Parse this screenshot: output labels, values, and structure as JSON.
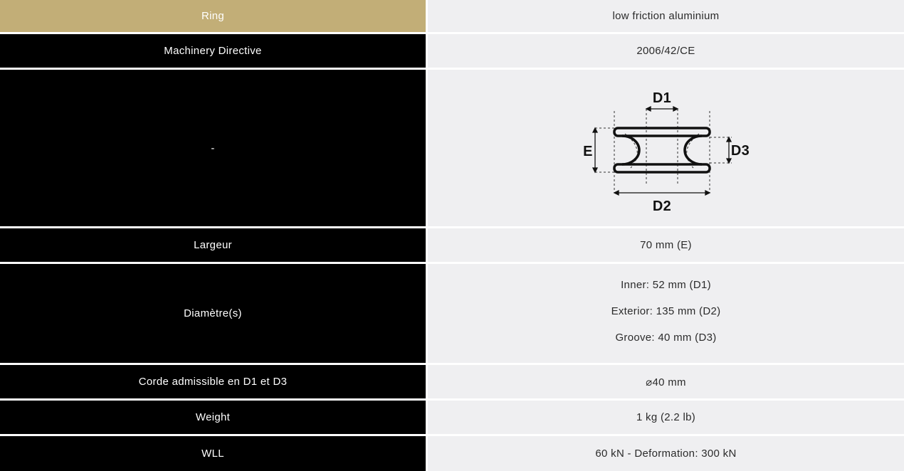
{
  "colors": {
    "header_label_bg": "#c2ae77",
    "label_bg": "#000000",
    "value_bg": "#efeff1"
  },
  "rows": [
    {
      "label": "Ring",
      "value": "low friction aluminium"
    },
    {
      "label": "Machinery Directive",
      "value": "2006/42/CE"
    },
    {
      "label": "-",
      "diagram_labels": {
        "d1": "D1",
        "d2": "D2",
        "d3": "D3",
        "e": "E"
      }
    },
    {
      "label": "Largeur",
      "value": "70 mm (E)"
    },
    {
      "label": "Diamètre(s)",
      "values": [
        "Inner: 52 mm (D1)",
        "Exterior: 135 mm (D2)",
        "Groove: 40 mm (D3)"
      ]
    },
    {
      "label": "Corde admissible en D1 et D3",
      "value": "⌀40 mm"
    },
    {
      "label": "Weight",
      "value": "1 kg (2.2 lb)"
    },
    {
      "label": "WLL",
      "value": "60 kN - Deformation: 300 kN"
    }
  ]
}
